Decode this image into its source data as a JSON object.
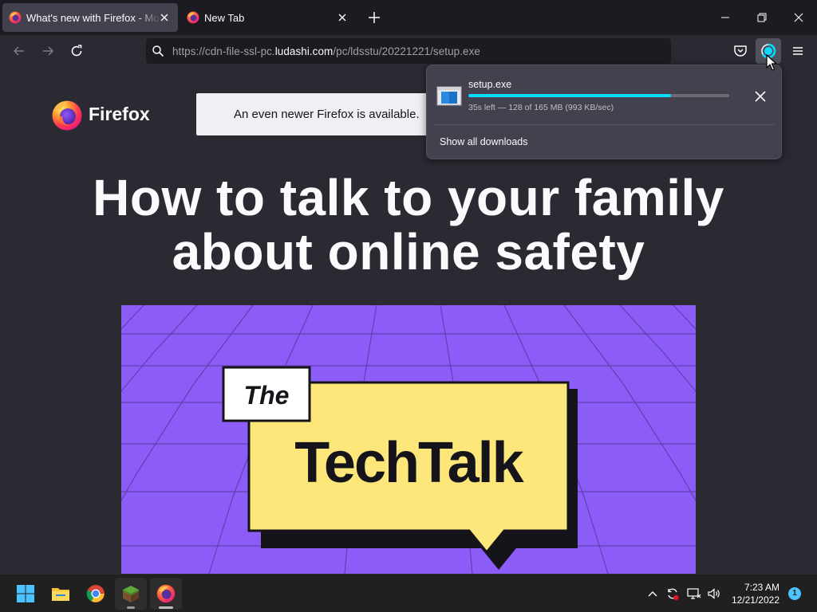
{
  "tabs": [
    {
      "title": "What's new with Firefox - More",
      "active": true
    },
    {
      "title": "New Tab",
      "active": false
    }
  ],
  "navbar": {
    "url_prefix": "https://cdn-file-ssl-pc.",
    "url_domain": "ludashi.com",
    "url_path": "/pc/ldsstu/20221221/setup.exe"
  },
  "page": {
    "brand": "Firefox",
    "update_notice": "An even newer Firefox is available.",
    "headline_line1": "How to talk to your family",
    "headline_line2": "about online safety",
    "hero": {
      "small_label": "The",
      "big_label": "TechTalk"
    }
  },
  "downloads_panel": {
    "file_name": "setup.exe",
    "status": "35s left — 128 of 165 MB (993 KB/sec)",
    "progress": 0.776,
    "show_all_label": "Show all downloads"
  },
  "taskbar": {
    "time": "7:23 AM",
    "date": "12/21/2022",
    "notification_count": "1",
    "apps": [
      "windows-start",
      "file-explorer",
      "chrome",
      "minecraft",
      "firefox"
    ]
  },
  "colors": {
    "accent": "#00ddff",
    "hero_background": "#8b5cf6",
    "speech_bubble": "#fde67a"
  }
}
